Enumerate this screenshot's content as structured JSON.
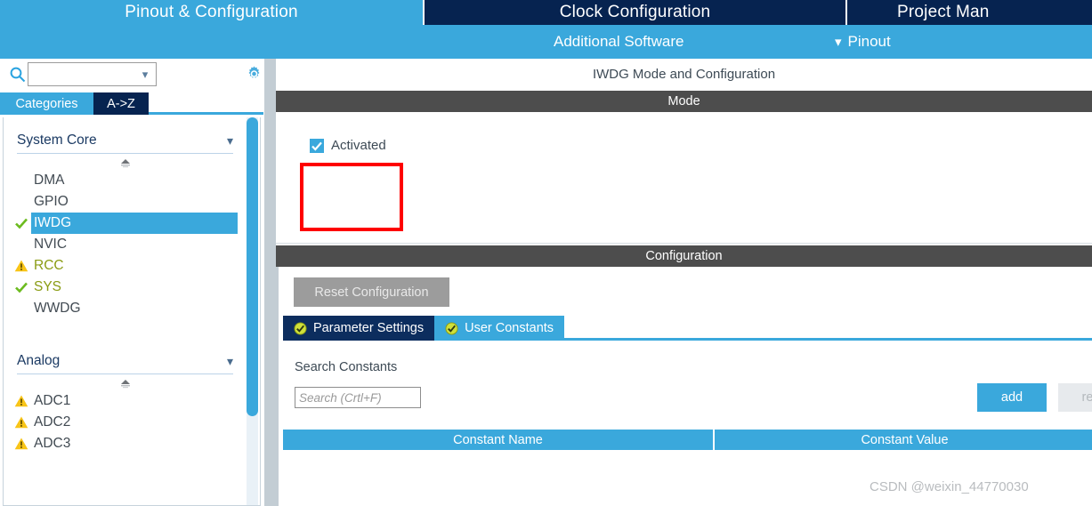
{
  "main_tabs": [
    {
      "label": "Pinout & Configuration",
      "active": true
    },
    {
      "label": "Clock Configuration",
      "active": false
    },
    {
      "label": "Project Man",
      "active": false
    }
  ],
  "sub_bar": {
    "additional_software": "Additional Software",
    "pinout": "Pinout",
    "pinout_chevron": "chevron-down-icon"
  },
  "sidebar": {
    "search": {
      "value": "",
      "placeholder": ""
    },
    "search_icon": "search-icon",
    "gear_icon": "gear-icon",
    "cat_tabs": [
      {
        "label": "Categories",
        "active": true
      },
      {
        "label": "A->Z",
        "active": false
      }
    ],
    "groups": [
      {
        "title": "System Core",
        "chevron": "chevron-down-icon",
        "items": [
          {
            "label": "DMA",
            "status": "none",
            "selected": false
          },
          {
            "label": "GPIO",
            "status": "none",
            "selected": false
          },
          {
            "label": "IWDG",
            "status": "check",
            "selected": true
          },
          {
            "label": "NVIC",
            "status": "none",
            "selected": false
          },
          {
            "label": "RCC",
            "status": "warn",
            "selected": false
          },
          {
            "label": "SYS",
            "status": "check",
            "selected": false
          },
          {
            "label": "WWDG",
            "status": "none",
            "selected": false
          }
        ]
      },
      {
        "title": "Analog",
        "chevron": "chevron-down-icon",
        "items": [
          {
            "label": "ADC1",
            "status": "warn",
            "selected": false
          },
          {
            "label": "ADC2",
            "status": "warn",
            "selected": false
          },
          {
            "label": "ADC3",
            "status": "warn",
            "selected": false
          }
        ]
      }
    ]
  },
  "right_panel": {
    "title": "IWDG Mode and Configuration",
    "mode_bar": "Mode",
    "activated_label": "Activated",
    "activated_checked": true,
    "config_bar": "Configuration",
    "reset_button": "Reset Configuration",
    "cfg_tabs": [
      {
        "label": "Parameter Settings",
        "active": true
      },
      {
        "label": "User Constants",
        "active": false
      }
    ],
    "search_constants_label": "Search Constants",
    "search_constants": {
      "value": "",
      "placeholder": "Search (Crtl+F)"
    },
    "add_button": "add",
    "remove_button": "rem",
    "table": {
      "columns": [
        "Constant Name",
        "Constant Value"
      ],
      "rows": []
    }
  },
  "watermark": "CSDN @weixin_44770030",
  "colors": {
    "accent_blue": "#3aa8dc",
    "navy": "#062350",
    "tab_navy": "#0c2d5e",
    "section_gray": "#4d4d4d",
    "warn_yellow": "#f5c518",
    "ok_green": "#7fbf1a",
    "annotation_red": "#fe0000"
  }
}
